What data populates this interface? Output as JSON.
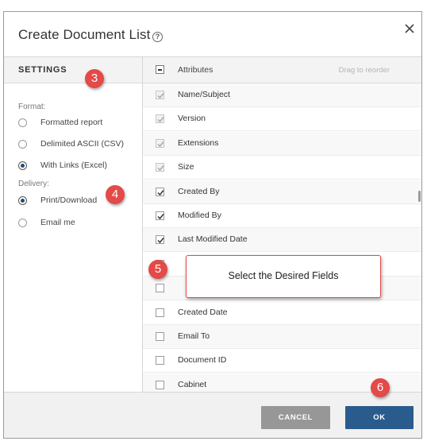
{
  "dialog": {
    "title": "Create Document List",
    "help_icon": "help-circle-icon",
    "close_icon": "close-icon"
  },
  "settings": {
    "header": "SETTINGS",
    "format_label": "Format:",
    "format_options": [
      {
        "label": "Formatted report",
        "selected": false
      },
      {
        "label": "Delimited ASCII (CSV)",
        "selected": false
      },
      {
        "label": "With Links (Excel)",
        "selected": true
      }
    ],
    "delivery_label": "Delivery:",
    "delivery_options": [
      {
        "label": "Print/Download",
        "selected": true
      },
      {
        "label": "Email me",
        "selected": false
      }
    ]
  },
  "attributes": {
    "header": "Attributes",
    "drag_hint": "Drag to reorder",
    "items": [
      {
        "label": "Name/Subject",
        "checked": true,
        "disabled": true
      },
      {
        "label": "Version",
        "checked": true,
        "disabled": true
      },
      {
        "label": "Extensions",
        "checked": true,
        "disabled": true
      },
      {
        "label": "Size",
        "checked": true,
        "disabled": true
      },
      {
        "label": "Created By",
        "checked": true,
        "disabled": false
      },
      {
        "label": "Modified By",
        "checked": true,
        "disabled": false
      },
      {
        "label": "Last Modified Date",
        "checked": true,
        "disabled": false
      },
      {
        "label": "",
        "checked": false,
        "disabled": false
      },
      {
        "label": "",
        "checked": false,
        "disabled": false
      },
      {
        "label": "Created Date",
        "checked": false,
        "disabled": false
      },
      {
        "label": "Email To",
        "checked": false,
        "disabled": false
      },
      {
        "label": "Document ID",
        "checked": false,
        "disabled": false
      },
      {
        "label": "Cabinet",
        "checked": false,
        "disabled": false
      }
    ]
  },
  "footer": {
    "cancel_label": "CANCEL",
    "ok_label": "OK"
  },
  "annotations": {
    "badge_3": "3",
    "badge_4": "4",
    "badge_5": "5",
    "badge_6": "6",
    "callout_text": "Select the Desired Fields",
    "color": "#e34a48"
  },
  "colors": {
    "primary_button": "#2a5b8d",
    "secondary_button": "#979797",
    "header_bg": "#f3f3f3"
  }
}
